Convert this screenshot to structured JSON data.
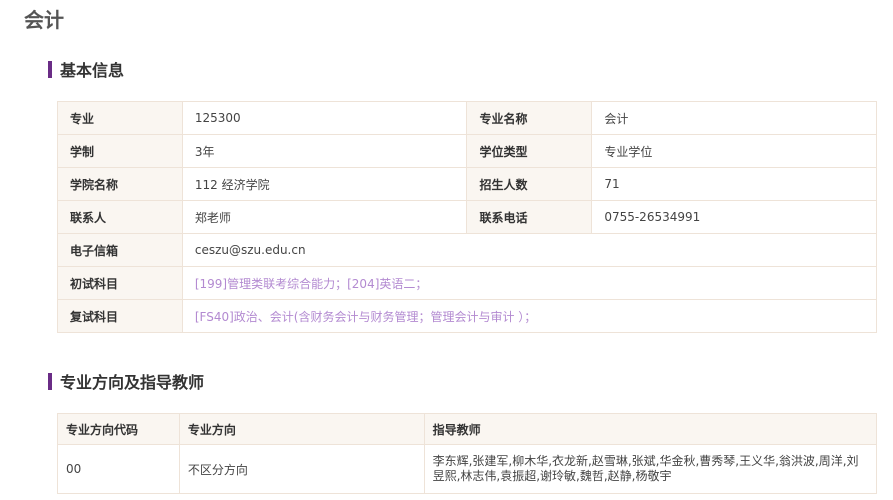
{
  "page_title": "会计",
  "basic_info": {
    "heading": "基本信息",
    "rows": [
      {
        "l1": "专业",
        "v1": "125300",
        "l2": "专业名称",
        "v2": "会计"
      },
      {
        "l1": "学制",
        "v1": "3年",
        "l2": "学位类型",
        "v2": "专业学位"
      },
      {
        "l1": "学院名称",
        "v1": "112 经济学院",
        "l2": "招生人数",
        "v2": "71"
      },
      {
        "l1": "联系人",
        "v1": "郑老师",
        "l2": "联系电话",
        "v2": "0755-26534991"
      }
    ],
    "email_label": "电子信箱",
    "email_value": "ceszu@szu.edu.cn",
    "prelim_label": "初试科目",
    "prelim_value": "[199]管理类联考综合能力；[204]英语二；",
    "retest_label": "复试科目",
    "retest_value": "[FS40]政治、会计(含财务会计与财务管理；管理会计与审计 ）；"
  },
  "directions": {
    "heading": "专业方向及指导教师",
    "columns": [
      "专业方向代码",
      "专业方向",
      "指导教师"
    ],
    "rows": [
      {
        "code": "00",
        "direction": "不区分方向",
        "teachers": "李东辉,张建军,柳木华,衣龙新,赵雪琳,张斌,华金秋,曹秀琴,王义华,翁洪波,周洋,刘昱熙,林志伟,袁振超,谢玲敏,魏哲,赵静,杨敬宇"
      }
    ]
  }
}
